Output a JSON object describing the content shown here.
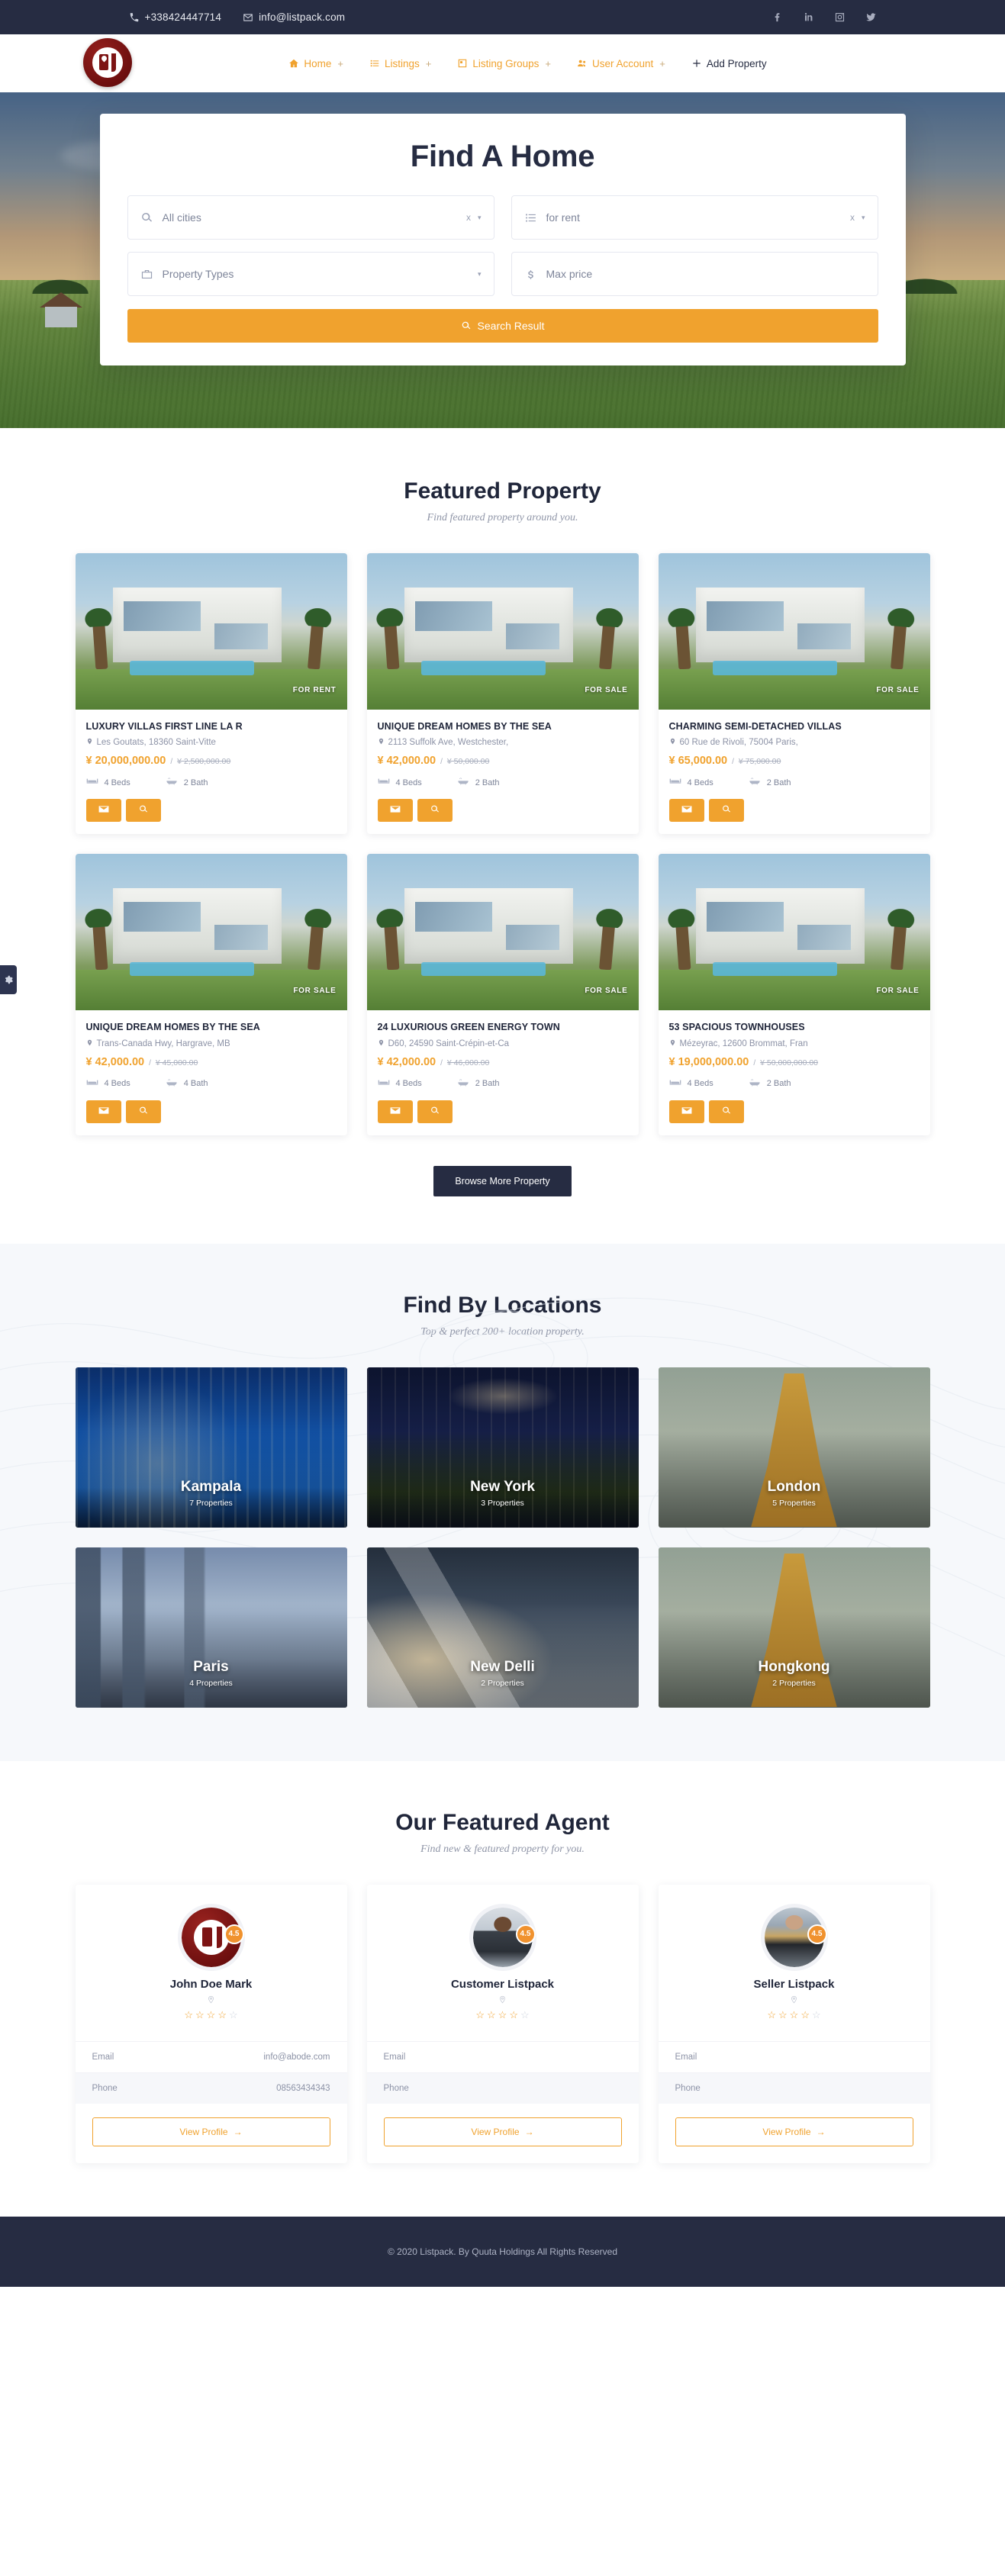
{
  "topbar": {
    "phone": "+338424447714",
    "email": "info@listpack.com",
    "phone_icon": "phone-icon",
    "email_icon": "envelope-icon",
    "socials": [
      {
        "name": "facebook-icon",
        "label": "Facebook"
      },
      {
        "name": "linkedin-icon",
        "label": "LinkedIn"
      },
      {
        "name": "instagram-icon",
        "label": "Instagram"
      },
      {
        "name": "twitter-icon",
        "label": "Twitter"
      }
    ]
  },
  "nav": {
    "brand_name": "Listpack",
    "items": [
      {
        "label": "Home",
        "icon": "home-icon",
        "plus": "+",
        "style": "accent"
      },
      {
        "label": "Listings",
        "icon": "list-icon",
        "plus": "+",
        "style": "accent"
      },
      {
        "label": "Listing Groups",
        "icon": "grid-icon",
        "plus": "+",
        "style": "accent"
      },
      {
        "label": "User Account",
        "icon": "users-icon",
        "plus": "+",
        "style": "accent"
      },
      {
        "label": "Add Property",
        "icon": "plus-icon",
        "plus": "",
        "style": "dark"
      }
    ]
  },
  "hero": {
    "title": "Find A Home",
    "fields": [
      {
        "name": "city-select",
        "icon": "search-icon",
        "value": "All cities",
        "clear": "x",
        "caret": "▾"
      },
      {
        "name": "status-select",
        "icon": "list-icon",
        "value": "for rent",
        "clear": "x",
        "caret": "▾"
      },
      {
        "name": "property-type-select",
        "icon": "briefcase-icon",
        "value": "Property Types",
        "clear": "",
        "caret": "▾"
      },
      {
        "name": "max-price-input",
        "icon": "dollar-icon",
        "value": "Max price",
        "clear": "",
        "caret": ""
      }
    ],
    "search_button": "Search Result"
  },
  "featured": {
    "title": "Featured Property",
    "subtitle": "Find featured property around you.",
    "browse_button": "Browse More Property",
    "properties": [
      {
        "title": "LUXURY VILLAS FIRST LINE LA R",
        "address": "Les Goutats, 18360 Saint-Vitte",
        "price": "¥ 20,000,000.00",
        "old_price": "¥ 2,500,000.00",
        "separator": "/",
        "beds": "4 Beds",
        "baths": "2 Bath",
        "badge": "FOR RENT",
        "image_class": "c1"
      },
      {
        "title": "UNIQUE DREAM HOMES BY THE SEA",
        "address": "2113 Suffolk Ave, Westchester,",
        "price": "¥ 42,000.00",
        "old_price": "¥ 50,000.00",
        "separator": "/",
        "beds": "4 Beds",
        "baths": "2 Bath",
        "badge": "FOR SALE",
        "image_class": "c2"
      },
      {
        "title": "CHARMING SEMI-DETACHED VILLAS",
        "address": "60 Rue de Rivoli, 75004 Paris,",
        "price": "¥ 65,000.00",
        "old_price": "¥ 75,000.00",
        "separator": "/",
        "beds": "4 Beds",
        "baths": "2 Bath",
        "badge": "FOR SALE",
        "image_class": "c3"
      },
      {
        "title": "UNIQUE DREAM HOMES BY THE SEA",
        "address": "Trans-Canada Hwy, Hargrave, MB",
        "price": "¥ 42,000.00",
        "old_price": "¥ 45,000.00",
        "separator": "/",
        "beds": "4 Beds",
        "baths": "4 Bath",
        "badge": "FOR SALE",
        "image_class": "c4"
      },
      {
        "title": "24 LUXURIOUS GREEN ENERGY TOWN",
        "address": "D60, 24590 Saint-Crépin-et-Ca",
        "price": "¥ 42,000.00",
        "old_price": "¥ 46,000.00",
        "separator": "/",
        "beds": "4 Beds",
        "baths": "2 Bath",
        "badge": "FOR SALE",
        "image_class": "c5"
      },
      {
        "title": "53 SPACIOUS TOWNHOUSES",
        "address": "Mézeyrac, 12600 Brommat, Fran",
        "price": "¥ 19,000,000.00",
        "old_price": "¥ 50,000,000.00",
        "separator": "/",
        "beds": "4 Beds",
        "baths": "2 Bath",
        "badge": "FOR SALE",
        "image_class": "c6"
      }
    ]
  },
  "locations": {
    "title": "Find By Locations",
    "subtitle": "Top & perfect 200+ location property.",
    "items": [
      {
        "name": "Kampala",
        "count": "7 Properties",
        "bg": "bg-kampala"
      },
      {
        "name": "New York",
        "count": "3 Properties",
        "bg": "bg-newyork"
      },
      {
        "name": "London",
        "count": "5 Properties",
        "bg": "bg-london"
      },
      {
        "name": "Paris",
        "count": "4 Properties",
        "bg": "bg-paris"
      },
      {
        "name": "New Delli",
        "count": "2 Properties",
        "bg": "bg-delhi"
      },
      {
        "name": "Hongkong",
        "count": "2 Properties",
        "bg": "bg-hongkong"
      }
    ]
  },
  "agents": {
    "title": "Our Featured Agent",
    "subtitle": "Find new & featured property for you.",
    "email_label": "Email",
    "phone_label": "Phone",
    "view_profile": "View Profile",
    "arrow": "→",
    "items": [
      {
        "name": "John Doe Mark",
        "rating_badge": "4.5",
        "stars_filled": 4,
        "stars_total": 5,
        "email": "info@abode.com",
        "phone": "08563434343",
        "avatar": "logo"
      },
      {
        "name": "Customer Listpack",
        "rating_badge": "4.5",
        "stars_filled": 4,
        "stars_total": 5,
        "email": "",
        "phone": "",
        "avatar": "photo-a"
      },
      {
        "name": "Seller Listpack",
        "rating_badge": "4.5",
        "stars_filled": 4,
        "stars_total": 5,
        "email": "",
        "phone": "",
        "avatar": "photo-b"
      }
    ]
  },
  "footer": {
    "copyright": "© 2020 Listpack. By Quuta Holdings All Rights Reserved"
  },
  "colors": {
    "accent": "#f0a22e",
    "dark": "#262c42",
    "brand_red": "#7d1414"
  }
}
